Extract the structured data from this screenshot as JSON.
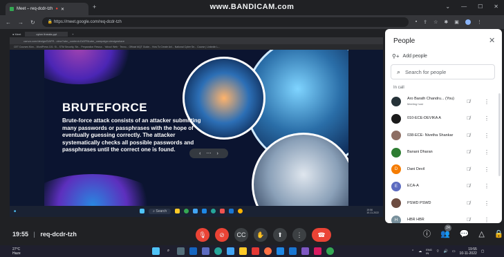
{
  "browser": {
    "tab_title": "Meet – req-dcdr-tzh",
    "watermark": "www.BANDICAM.com",
    "url": "https://meet.google.com/req-dcdr-tzh"
  },
  "shared_screen": {
    "tab_title": "cyber threats.ppt",
    "url": "canva.com/design/DAFR...view?utm_content=DAFR&utm_campaign=designshare",
    "bookmarks": "CET Courses Mon...   WordPress 101: Si...   STM Security, Sin...   Preparation Resour...   Yahoo! Web · Tecno...   Official MQT Guide...   How To Create Anl...   National Cyber Se...   Course | Linkedin L...",
    "slide_title": "BRUTEFORCE",
    "slide_body": "Brute-force attack consists of an attacker submitting many passwords or passphrases with the hope of eventually guessing correctly. The attacker systematically checks all possible passwords and passphrases until the correct one is found.",
    "inner_search": "Search",
    "inner_clock": "19:56\n10-11-2022"
  },
  "meeting": {
    "time": "19:55",
    "separator": "|",
    "code": "req-dcdr-tzh",
    "people_count": "24"
  },
  "people_panel": {
    "title": "People",
    "add_people": "Add people",
    "search_placeholder": "Search for people",
    "section_label": "In call",
    "participants": [
      {
        "name": "Aro Barath Chandru... (You)",
        "sub": "Meeting host",
        "avatar_color": "#263238",
        "initial": ""
      },
      {
        "name": "010-ECE-DEVIKA A",
        "sub": "",
        "avatar_color": "#1b1b1b",
        "initial": ""
      },
      {
        "name": "038-ECE- Nivetha Shankar",
        "sub": "",
        "avatar_color": "#8d6e63",
        "initial": ""
      },
      {
        "name": "Banani Dharan",
        "sub": "",
        "avatar_color": "#2e7d32",
        "initial": ""
      },
      {
        "name": "Dani Devil",
        "sub": "",
        "avatar_color": "#f57c00",
        "initial": "D"
      },
      {
        "name": "ECA-A",
        "sub": "",
        "avatar_color": "#5c6bc0",
        "initial": "E"
      },
      {
        "name": "PSWD PSWD",
        "sub": "",
        "avatar_color": "#6d4c41",
        "initial": ""
      },
      {
        "name": "HBR HBR",
        "sub": "",
        "avatar_color": "#78909c",
        "initial": "H"
      }
    ]
  },
  "taskbar": {
    "weather_temp": "27°C",
    "weather_desc": "Haze",
    "lang": "ENG\nIN",
    "time": "19:55",
    "date": "10-11-2022"
  }
}
